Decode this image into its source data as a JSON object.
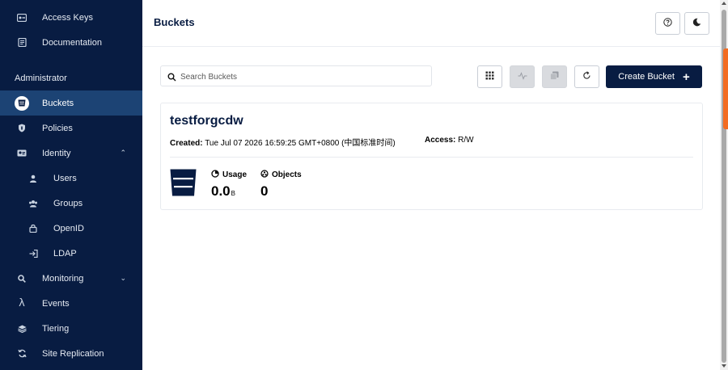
{
  "sidebar": {
    "top_items": [
      {
        "label": "Access Keys",
        "icon": "key-icon"
      },
      {
        "label": "Documentation",
        "icon": "document-icon"
      }
    ],
    "section_title": "Administrator",
    "items": [
      {
        "label": "Buckets",
        "icon": "bucket-icon",
        "active": true
      },
      {
        "label": "Policies",
        "icon": "shield-icon"
      },
      {
        "label": "Identity",
        "icon": "id-card-icon",
        "expanded": true
      },
      {
        "label": "Users",
        "icon": "user-icon"
      },
      {
        "label": "Groups",
        "icon": "groups-icon"
      },
      {
        "label": "OpenID",
        "icon": "lock-icon"
      },
      {
        "label": "LDAP",
        "icon": "login-icon"
      },
      {
        "label": "Monitoring",
        "icon": "search-icon",
        "expanded": false
      },
      {
        "label": "Events",
        "icon": "lambda-icon"
      },
      {
        "label": "Tiering",
        "icon": "layers-icon"
      },
      {
        "label": "Site Replication",
        "icon": "sync-icon"
      }
    ]
  },
  "header": {
    "title": "Buckets",
    "help_icon": "help-icon",
    "theme_icon": "moon-icon"
  },
  "toolbar": {
    "search_placeholder": "Search Buckets",
    "create_label": "Create Bucket",
    "buttons": [
      "grid-icon",
      "lifecycle-icon",
      "copy-icon",
      "refresh-icon"
    ]
  },
  "bucket": {
    "name": "testforgcdw",
    "created_label": "Created:",
    "created_value": "Tue Jul 07 2026 16:59:25 GMT+0800 (中国标准时间)",
    "access_label": "Access:",
    "access_value": "R/W",
    "usage_label": "Usage",
    "usage_value": "0.0",
    "usage_unit": "B",
    "objects_label": "Objects",
    "objects_value": "0"
  },
  "colors": {
    "sidebar_bg": "#081c42",
    "active_item_bg": "#1c4374",
    "primary": "#081c42",
    "scroll_accent": "#f36c21"
  }
}
